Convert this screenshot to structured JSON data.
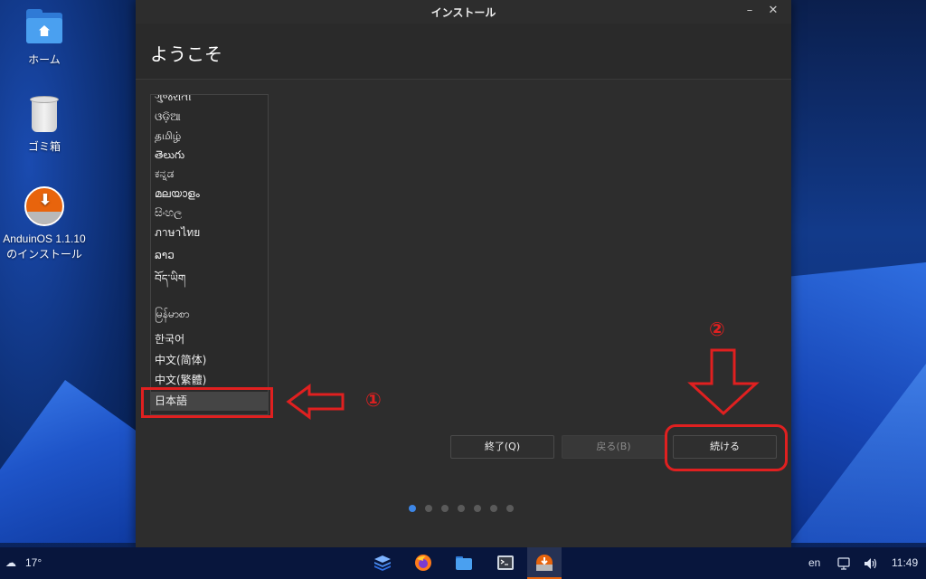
{
  "desktop": {
    "icons": [
      {
        "label": "ホーム",
        "icon": "home-folder-icon"
      },
      {
        "label": "ゴミ箱",
        "icon": "trash-icon"
      },
      {
        "label_line1": "AnduinOS 1.1.10",
        "label_line2": "のインストール",
        "icon": "anduin-installer-icon"
      }
    ]
  },
  "window": {
    "title": "インストール",
    "heading": "ようこそ",
    "languages": [
      "ગુજરાતી",
      "ଓଡ଼ିଆ",
      "தமிழ்",
      "తెలుగు",
      "ಕನ್ನಡ",
      "മലയാളം",
      "සිංහල",
      "ภาษาไทย",
      "ລາວ",
      "བོད་ཡིག",
      "မြန်မာစာ",
      "한국어",
      "中文(简体)",
      "中文(繁體)",
      "日本語"
    ],
    "selected_language": "日本語",
    "buttons": {
      "quit": "終了(Q)",
      "back": "戻る(B)",
      "continue": "続ける"
    },
    "pager": {
      "total": 7,
      "active": 1
    }
  },
  "annotations": {
    "step1": "①",
    "step2": "②",
    "color": "#e02020"
  },
  "taskbar": {
    "weather": {
      "icon": "cloud-icon",
      "temp": "17°"
    },
    "apps": [
      "files-stack-icon",
      "firefox-icon",
      "folder-icon",
      "terminal-icon",
      "anduin-installer-icon"
    ],
    "keyboard_lang": "en",
    "time": "11:49"
  },
  "colors": {
    "window_bg": "#2d2d2d",
    "accent": "#3d86e6",
    "brand": "#e8640c"
  }
}
